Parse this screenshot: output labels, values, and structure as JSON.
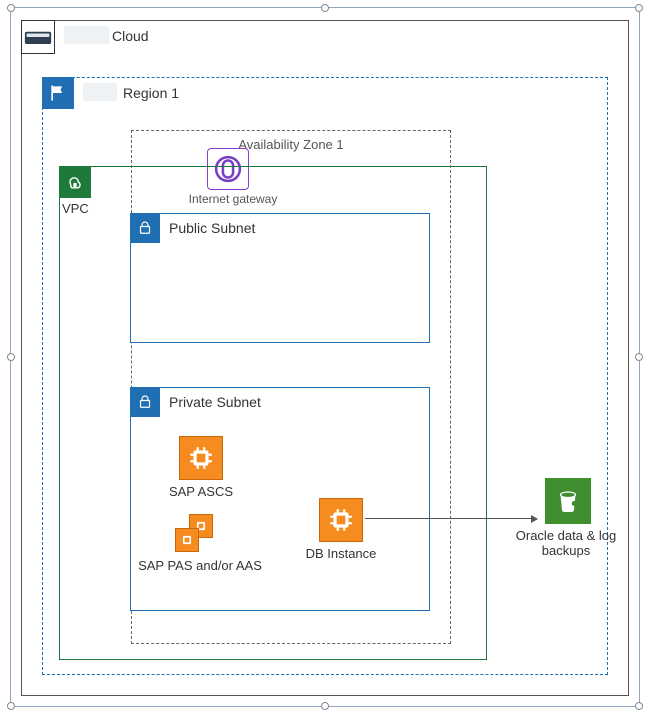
{
  "cloud": {
    "label": "Cloud"
  },
  "region": {
    "label": "Region 1"
  },
  "az": {
    "label": "Availability Zone 1"
  },
  "vpc": {
    "label": "VPC"
  },
  "igw": {
    "label": "Internet gateway"
  },
  "public_subnet": {
    "label": "Public Subnet"
  },
  "private_subnet": {
    "label": "Private Subnet"
  },
  "ascs": {
    "label": "SAP ASCS"
  },
  "pas": {
    "label": "SAP PAS and/or AAS"
  },
  "db": {
    "label": "DB Instance"
  },
  "s3": {
    "label": "Oracle data & log backups"
  }
}
